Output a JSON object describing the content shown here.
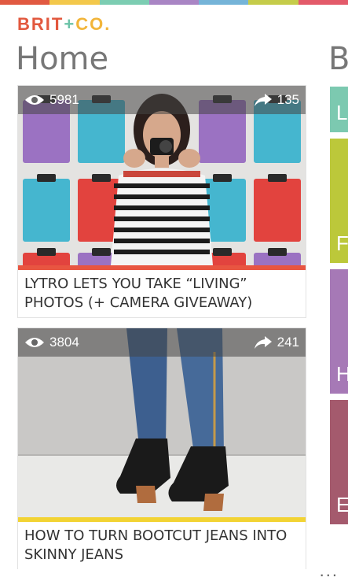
{
  "header": {
    "logo": {
      "brit": "BRIT",
      "plus": "+",
      "co": "CO."
    },
    "title": "Home",
    "next_pivot_peek": "B"
  },
  "colors": {
    "stripe": [
      "#e15941",
      "#f3c84b",
      "#7ccdb2",
      "#a985c4",
      "#75b4d8",
      "#c5cc4a",
      "#e35a6a"
    ],
    "card1_bar": "#e85541",
    "card2_bar": "#f2d334",
    "side_tiles": [
      "#7cc9b0",
      "#bcc83a",
      "#a679b6",
      "#a45a6d"
    ]
  },
  "cards": [
    {
      "views": "5981",
      "shares": "135",
      "title": "LYTRO LETS YOU TAKE “LIVING” PHOTOS (+ CAMERA GIVEAWAY)"
    },
    {
      "views": "3804",
      "shares": "241",
      "title": "HOW TO TURN BOOTCUT JEANS INTO SKINNY JEANS"
    }
  ],
  "side_tiles": [
    {
      "letter": "L"
    },
    {
      "letter": "F"
    },
    {
      "letter": "H"
    },
    {
      "letter": "E"
    }
  ],
  "app_bar": {
    "more": "..."
  }
}
